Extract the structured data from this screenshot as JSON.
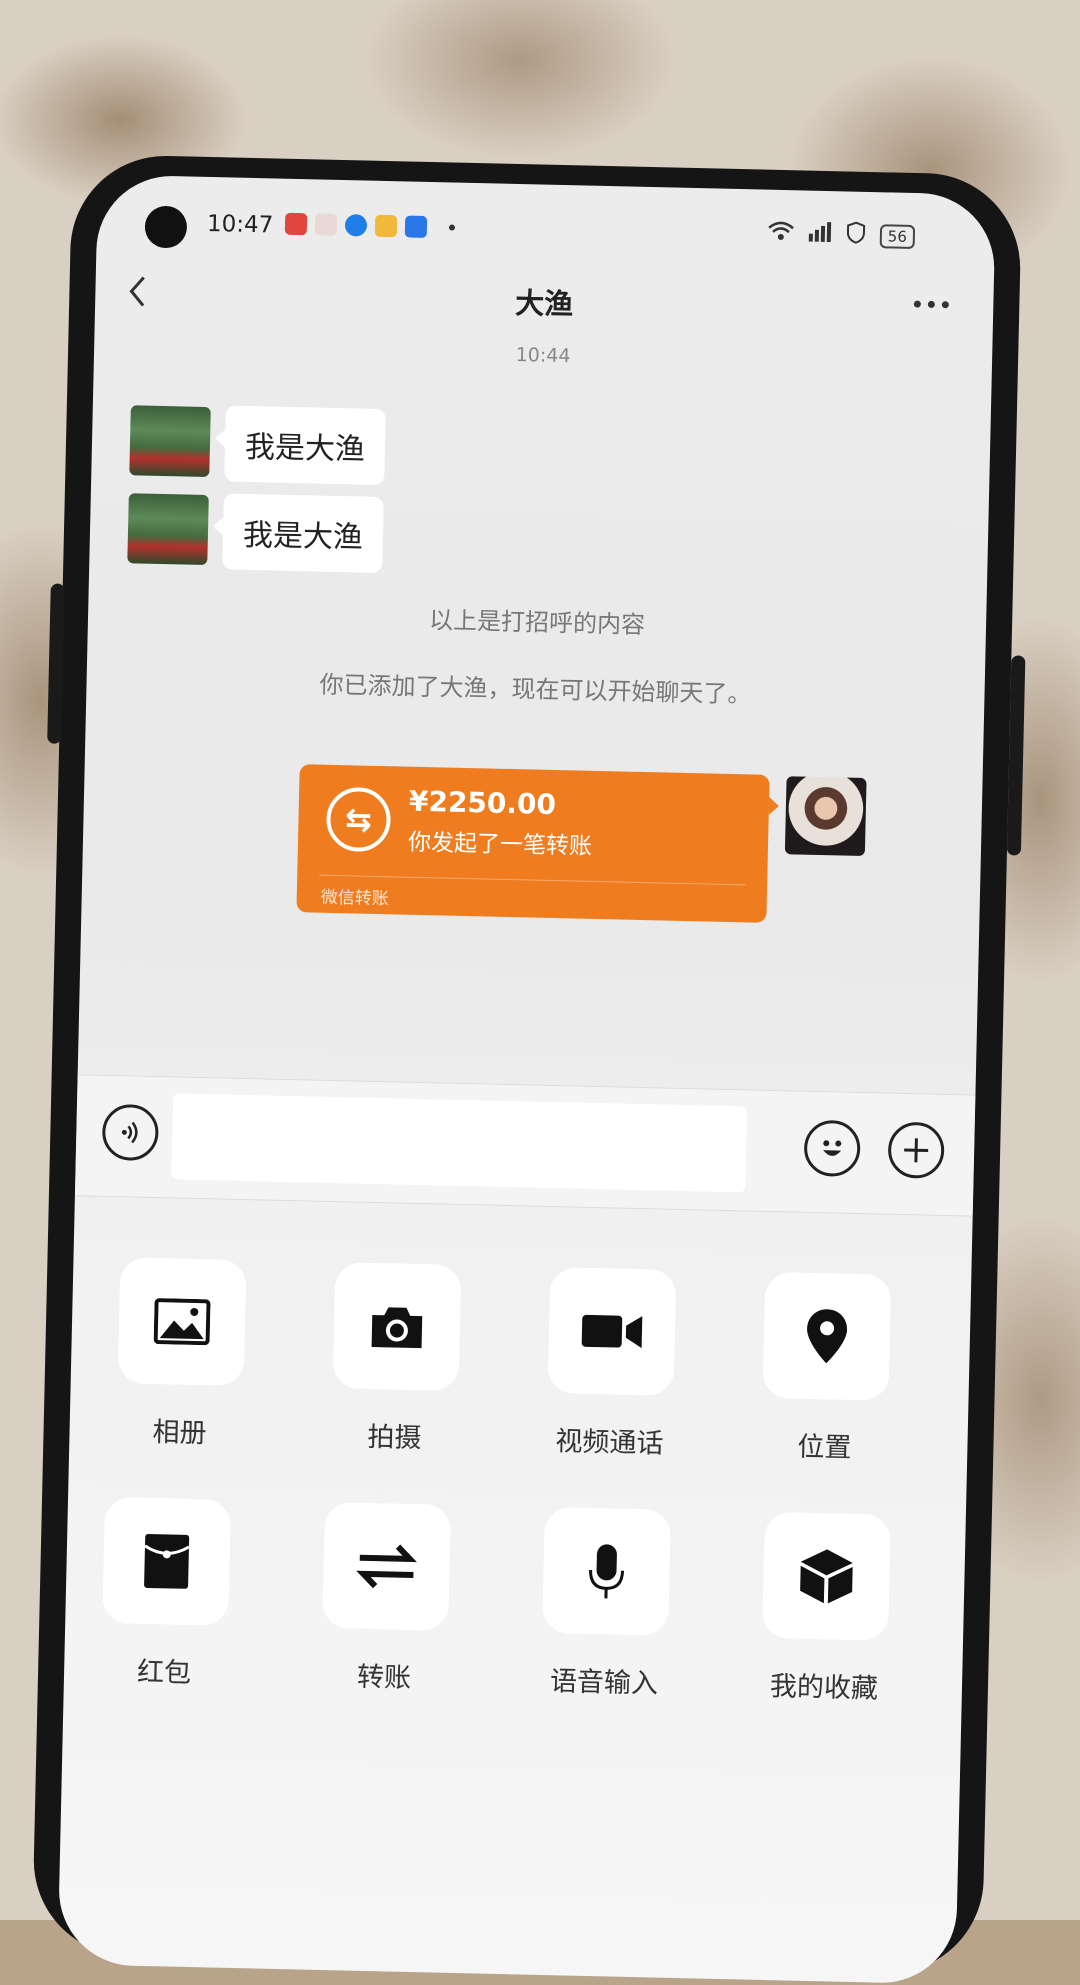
{
  "status_bar": {
    "time": "10:47",
    "battery": "56"
  },
  "header": {
    "title": "大渔",
    "back_icon": "chevron-left-icon",
    "more_icon": "more-dots-icon"
  },
  "chat": {
    "timestamp": "10:44",
    "messages": [
      {
        "from": "contact",
        "text": "我是大渔"
      },
      {
        "from": "contact",
        "text": "我是大渔"
      }
    ],
    "system_notes": [
      "以上是打招呼的内容",
      "你已添加了大渔，现在可以开始聊天了。"
    ],
    "transfer": {
      "amount": "¥2250.00",
      "description": "你发起了一笔转账",
      "footer": "微信转账",
      "color": "#ef7d1f"
    }
  },
  "input_bar": {
    "value": "",
    "voice_icon": "voice-icon",
    "emoji_icon": "emoji-icon",
    "plus_icon": "plus-icon"
  },
  "tools": [
    {
      "label": "相册",
      "icon": "image-icon"
    },
    {
      "label": "拍摄",
      "icon": "camera-icon"
    },
    {
      "label": "视频通话",
      "icon": "video-icon"
    },
    {
      "label": "位置",
      "icon": "location-icon"
    },
    {
      "label": "红包",
      "icon": "red-packet-icon"
    },
    {
      "label": "转账",
      "icon": "transfer-icon"
    },
    {
      "label": "语音输入",
      "icon": "microphone-icon"
    },
    {
      "label": "我的收藏",
      "icon": "favorites-icon"
    }
  ]
}
